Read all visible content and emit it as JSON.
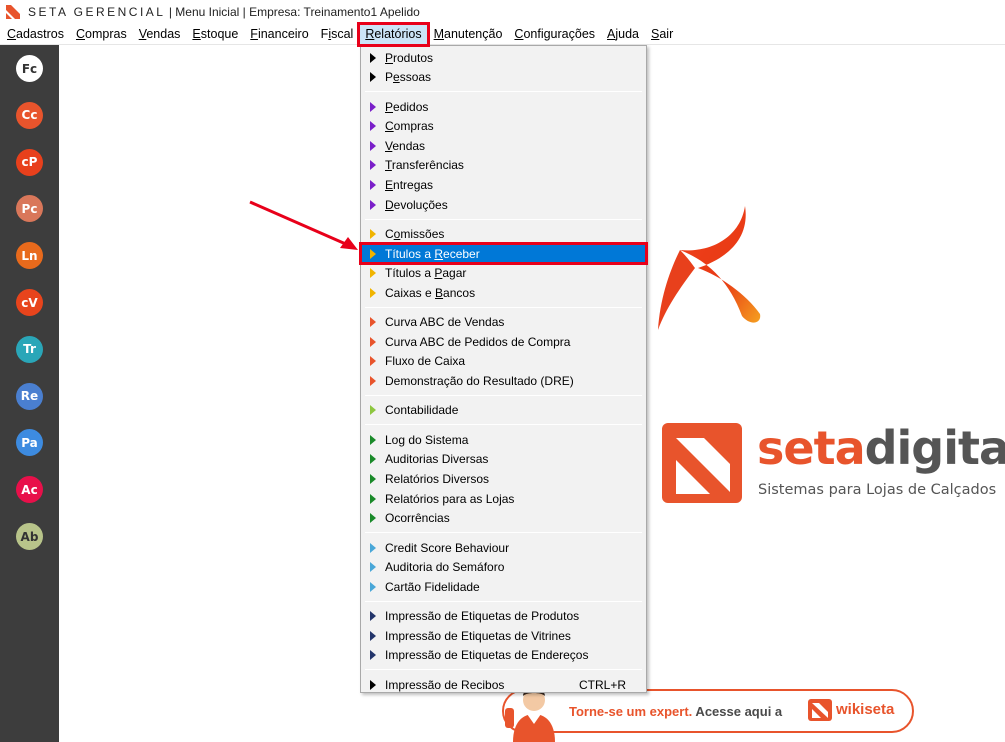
{
  "window": {
    "brand": "SETA GERENCIAL",
    "title_rest": " | Menu Inicial | Empresa: Treinamento1 Apelido"
  },
  "menubar": [
    {
      "pre": "",
      "ul": "C",
      "post": "adastros"
    },
    {
      "pre": "",
      "ul": "C",
      "post": "ompras"
    },
    {
      "pre": "",
      "ul": "V",
      "post": "endas"
    },
    {
      "pre": "",
      "ul": "E",
      "post": "stoque"
    },
    {
      "pre": "",
      "ul": "F",
      "post": "inanceiro"
    },
    {
      "pre": "F",
      "ul": "i",
      "post": "scal"
    },
    {
      "pre": "",
      "ul": "R",
      "post": "elatórios"
    },
    {
      "pre": "",
      "ul": "M",
      "post": "anutenção"
    },
    {
      "pre": "",
      "ul": "C",
      "post": "onfigurações"
    },
    {
      "pre": "",
      "ul": "A",
      "post": "juda"
    },
    {
      "pre": "",
      "ul": "S",
      "post": "air"
    }
  ],
  "sidebar": [
    {
      "label": "Fc",
      "color": "#ffffff",
      "text_color": "#333333"
    },
    {
      "label": "Cc",
      "color": "#e8542c",
      "text_color": "#ffffff"
    },
    {
      "label": "cP",
      "color": "#e8401c",
      "text_color": "#ffffff"
    },
    {
      "label": "Pc",
      "color": "#d9775a",
      "text_color": "#ffffff"
    },
    {
      "label": "Ln",
      "color": "#e86a1c",
      "text_color": "#ffffff"
    },
    {
      "label": "cV",
      "color": "#e8441c",
      "text_color": "#ffffff"
    },
    {
      "label": "Tr",
      "color": "#2aa6b8",
      "text_color": "#ffffff"
    },
    {
      "label": "Re",
      "color": "#4a7fd0",
      "text_color": "#ffffff"
    },
    {
      "label": "Pa",
      "color": "#3d8be0",
      "text_color": "#ffffff"
    },
    {
      "label": "Ac",
      "color": "#e8104a",
      "text_color": "#ffffff"
    },
    {
      "label": "Ab",
      "color": "#b8c48a",
      "text_color": "#333333"
    }
  ],
  "dropdown": [
    {
      "pre": "",
      "ul": "P",
      "post": "rodutos",
      "arrow_color": "#000000"
    },
    {
      "pre": "P",
      "ul": "e",
      "post": "ssoas",
      "arrow_color": "#000000"
    },
    {
      "sep": true
    },
    {
      "pre": "",
      "ul": "P",
      "post": "edidos",
      "arrow_color": "#7a1fc9"
    },
    {
      "pre": "",
      "ul": "C",
      "post": "ompras",
      "arrow_color": "#7a1fc9"
    },
    {
      "pre": "",
      "ul": "V",
      "post": "endas",
      "arrow_color": "#7a1fc9"
    },
    {
      "pre": "",
      "ul": "T",
      "post": "ransferências",
      "arrow_color": "#7a1fc9"
    },
    {
      "pre": "",
      "ul": "E",
      "post": "ntregas",
      "arrow_color": "#7a1fc9"
    },
    {
      "pre": "",
      "ul": "D",
      "post": "evoluções",
      "arrow_color": "#7a1fc9"
    },
    {
      "sep": true
    },
    {
      "pre": "C",
      "ul": "o",
      "post": "missões",
      "arrow_color": "#f0b400"
    },
    {
      "pre": "Títulos a ",
      "ul": "R",
      "post": "eceber",
      "arrow_color": "#f0b400",
      "highlight": true
    },
    {
      "pre": "Títulos a ",
      "ul": "P",
      "post": "agar",
      "arrow_color": "#f0b400"
    },
    {
      "pre": "Caixas e ",
      "ul": "B",
      "post": "ancos",
      "arrow_color": "#f0b400"
    },
    {
      "sep": true
    },
    {
      "pre": "Curva ABC de Vendas",
      "ul": "",
      "post": "",
      "arrow_color": "#e8542c"
    },
    {
      "pre": "Curva ABC de Pedidos de Compra",
      "ul": "",
      "post": "",
      "arrow_color": "#e8542c"
    },
    {
      "pre": "Fluxo de Caixa",
      "ul": "",
      "post": "",
      "arrow_color": "#e8542c"
    },
    {
      "pre": "Demonstração do Resultado (DRE)",
      "ul": "",
      "post": "",
      "arrow_color": "#e8542c"
    },
    {
      "sep": true
    },
    {
      "pre": "Contabilidade",
      "ul": "",
      "post": "",
      "arrow_color": "#8dc63f"
    },
    {
      "sep": true
    },
    {
      "pre": "Log do Sistema",
      "ul": "",
      "post": "",
      "arrow_color": "#1a8a2a"
    },
    {
      "pre": "Auditorias Diversas",
      "ul": "",
      "post": "",
      "arrow_color": "#1a8a2a"
    },
    {
      "pre": "Relatórios Diversos",
      "ul": "",
      "post": "",
      "arrow_color": "#1a8a2a"
    },
    {
      "pre": "Relatórios para as Lojas",
      "ul": "",
      "post": "",
      "arrow_color": "#1a8a2a"
    },
    {
      "pre": "Ocorrências",
      "ul": "",
      "post": "",
      "arrow_color": "#1a8a2a"
    },
    {
      "sep": true
    },
    {
      "pre": "Credit Score Behaviour",
      "ul": "",
      "post": "",
      "arrow_color": "#49a7d8"
    },
    {
      "pre": "Auditoria do Semáforo",
      "ul": "",
      "post": "",
      "arrow_color": "#49a7d8"
    },
    {
      "pre": "Cartão Fidelidade",
      "ul": "",
      "post": "",
      "arrow_color": "#49a7d8"
    },
    {
      "sep": true
    },
    {
      "pre": "Impressão de Etiquetas de Produtos",
      "ul": "",
      "post": "",
      "arrow_color": "#23356b"
    },
    {
      "pre": "Impressão de Etiquetas de Vitrines",
      "ul": "",
      "post": "",
      "arrow_color": "#23356b"
    },
    {
      "pre": "Impressão de Etiquetas de Endereços",
      "ul": "",
      "post": "",
      "arrow_color": "#23356b"
    },
    {
      "sep": true
    },
    {
      "pre": "Impressão de Recibos",
      "ul": "",
      "post": "",
      "arrow_color": "#000000",
      "shortcut": "CTRL+R"
    }
  ],
  "branding": {
    "word1": "seta",
    "word2": "digital",
    "tagline": "Sistemas para Lojas de Calçados",
    "accent_color": "#e8542c"
  },
  "wiki": {
    "text_orange": "Torne-se um expert.",
    "text_gray": " Acesse aqui a",
    "brand": "wikiseta"
  }
}
